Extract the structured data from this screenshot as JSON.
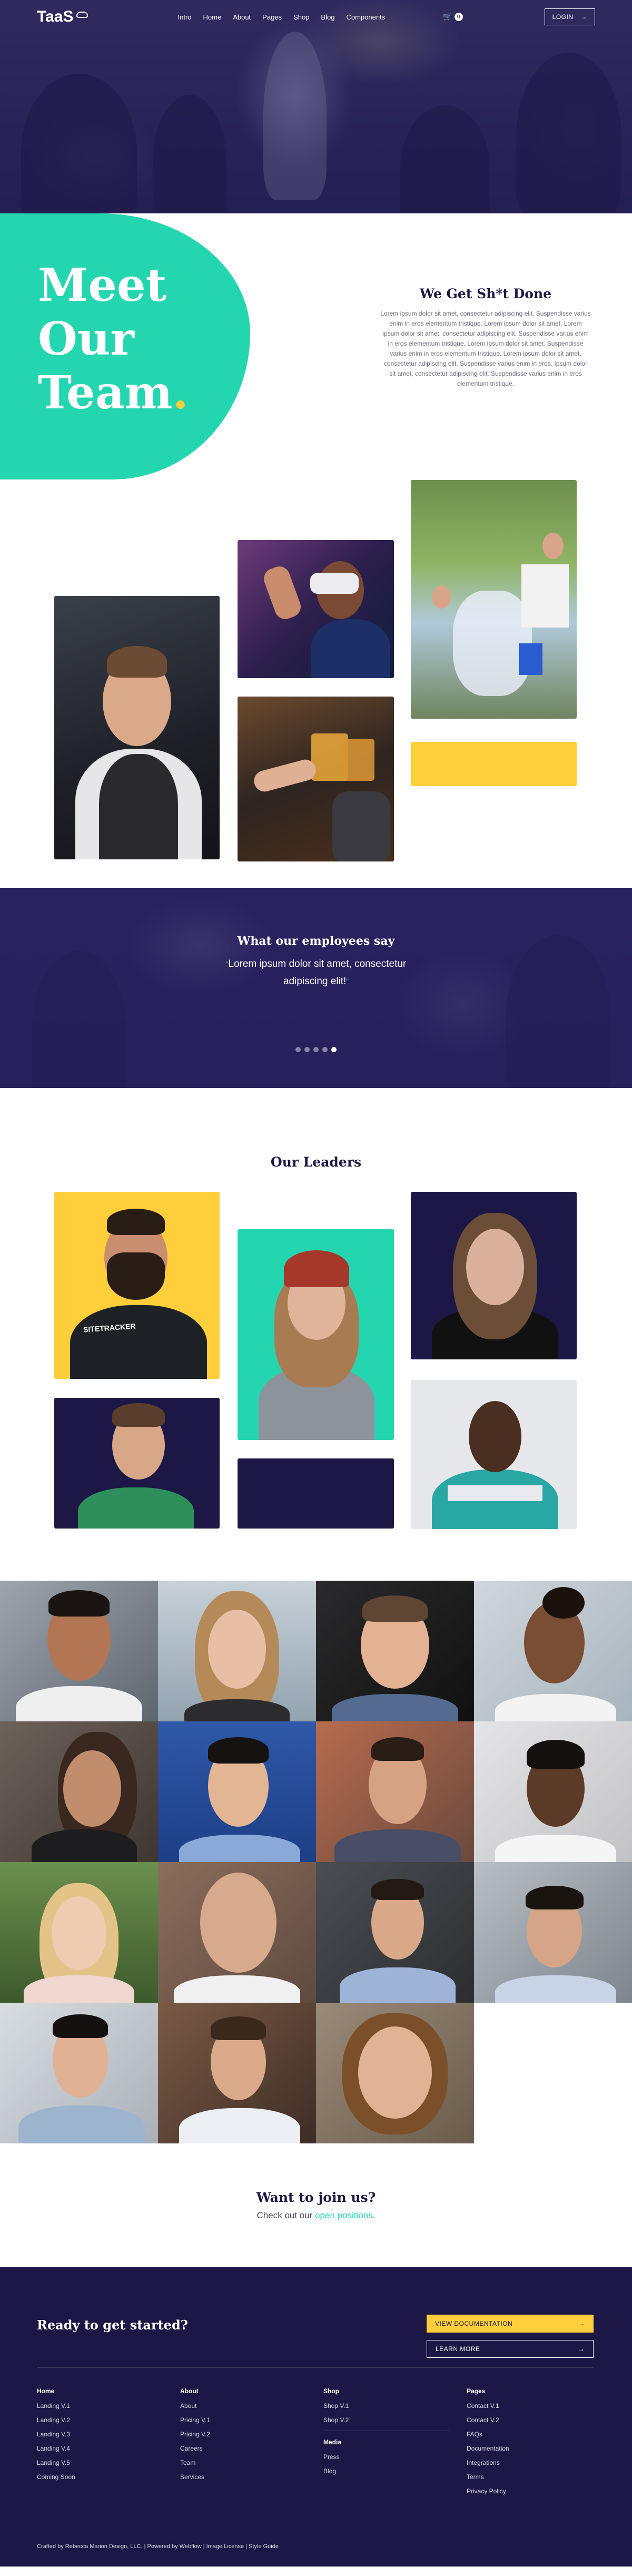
{
  "nav": {
    "logo": "TaaS",
    "menu": [
      "Intro",
      "Home",
      "About",
      "Pages",
      "Shop",
      "Blog",
      "Components"
    ],
    "cart_count": "0",
    "login": "LOGIN"
  },
  "meet": {
    "line1": "Meet",
    "line2": "Our",
    "line3": "Team",
    "dot": ".",
    "heading": "We Get Sh*t Done",
    "body": "Lorem ipsum dolor sit amet, consectetur adipiscing elit. Suspendisse varius enim in eros elementum tristique. Lorem ipsum dolor sit amet, Lorem ipsum dolor sit amet, consectetur adipiscing elit. Suspendisse varius enim in eros elementum tristique. Lorem ipsum dolor sit amet. Suspendisse varius enim in eros elementum tristique. Lorem ipsum dolor sit amet, consectetur adipiscing elit. Suspendisse varius enim in eros. Ipsum dolor sit amet, consectetur adipiscing elit. Suspendisse varius enim in eros elementum tristique."
  },
  "testimonial": {
    "heading": "What our employees say",
    "quote_line1": "Lorem ipsum dolor sit amet, consectetur",
    "quote_line2": "adipiscing elit!",
    "open_quote": "“",
    "close_quote": "”",
    "slides": 5,
    "active_slide": 5
  },
  "leaders": {
    "heading": "Our Leaders",
    "shirt_text": "SITETRACKER"
  },
  "join": {
    "heading": "Want to join us?",
    "text_prefix": "Check out our ",
    "link": "open positions",
    "text_suffix": "."
  },
  "footer": {
    "cta": "Ready to get started?",
    "doc_button": "VIEW DOCUMENTATION",
    "more_button": "LEARN MORE",
    "arrow": "→",
    "columns": [
      {
        "title": "Home",
        "links": [
          "Landing V.1",
          "Landing V.2",
          "Landing V.3",
          "Landing V.4",
          "Landing V.5",
          "Coming Soon"
        ]
      },
      {
        "title": "About",
        "links": [
          "About",
          "Pricing V.1",
          "Pricing V.2",
          "Careers",
          "Team",
          "Services"
        ]
      },
      {
        "title": "Shop",
        "links": [
          "Shop V.1",
          "Shop V.2"
        ],
        "title2": "Media",
        "links2": [
          "Press",
          "Blog"
        ]
      },
      {
        "title": "Pages",
        "links": [
          "Contact V.1",
          "Contact V.2",
          "FAQs",
          "Documentation",
          "Integrations",
          "Terms",
          "Privacy Policy"
        ]
      }
    ],
    "credits": "Crafted by Rebecca Marion Design, LLC.  |  Powered by Webflow  |  Image License  |  Style Guide"
  },
  "colors": {
    "navy": "#1c1744",
    "teal": "#24d6b0",
    "yellow": "#fecf3a"
  }
}
